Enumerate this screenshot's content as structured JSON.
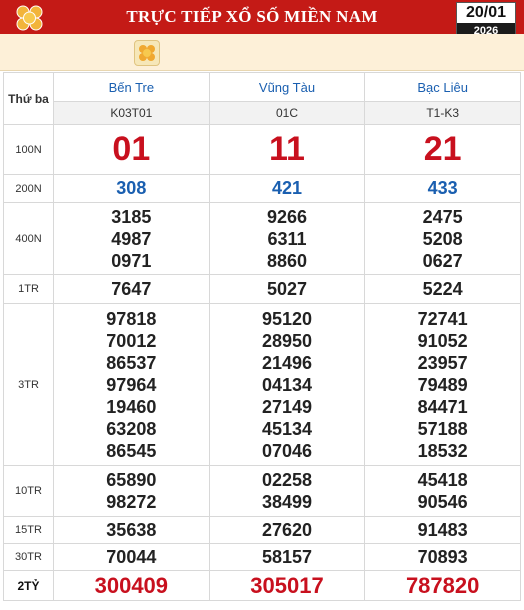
{
  "header": {
    "title": "TRỰC TIẾP XỔ SỐ MIỀN NAM",
    "date": "20/01",
    "year": "2026",
    "logo_icon": "lottery-balls-icon",
    "accent": "#c41a16"
  },
  "table": {
    "weekday": "Thứ ba",
    "provinces": [
      {
        "name": "Bến Tre",
        "code": "K03T01"
      },
      {
        "name": "Vũng Tàu",
        "code": "01C"
      },
      {
        "name": "Bạc Liêu",
        "code": "T1-K3"
      }
    ],
    "prizes": {
      "g8": {
        "label": "100N",
        "values": [
          "01",
          "11",
          "21"
        ]
      },
      "g7": {
        "label": "200N",
        "values": [
          "308",
          "421",
          "433"
        ]
      },
      "g6": {
        "label": "400N",
        "values": [
          [
            "3185",
            "4987",
            "0971"
          ],
          [
            "9266",
            "6311",
            "8860"
          ],
          [
            "2475",
            "5208",
            "0627"
          ]
        ]
      },
      "g5": {
        "label": "1TR",
        "values": [
          "7647",
          "5027",
          "5224"
        ]
      },
      "g4": {
        "label": "3TR",
        "values": [
          [
            "97818",
            "70012",
            "86537",
            "97964",
            "19460",
            "63208",
            "86545"
          ],
          [
            "95120",
            "28950",
            "21496",
            "04134",
            "27149",
            "45134",
            "07046"
          ],
          [
            "72741",
            "91052",
            "23957",
            "79489",
            "84471",
            "57188",
            "18532"
          ]
        ]
      },
      "g3": {
        "label": "10TR",
        "values": [
          [
            "65890",
            "98272"
          ],
          [
            "02258",
            "38499"
          ],
          [
            "45418",
            "90546"
          ]
        ]
      },
      "g2": {
        "label": "15TR",
        "values": [
          "35638",
          "27620",
          "91483"
        ]
      },
      "g1": {
        "label": "30TR",
        "values": [
          "70044",
          "58157",
          "70893"
        ]
      },
      "db": {
        "label": "2TỶ",
        "values": [
          "300409",
          "305017",
          "787820"
        ]
      }
    }
  }
}
